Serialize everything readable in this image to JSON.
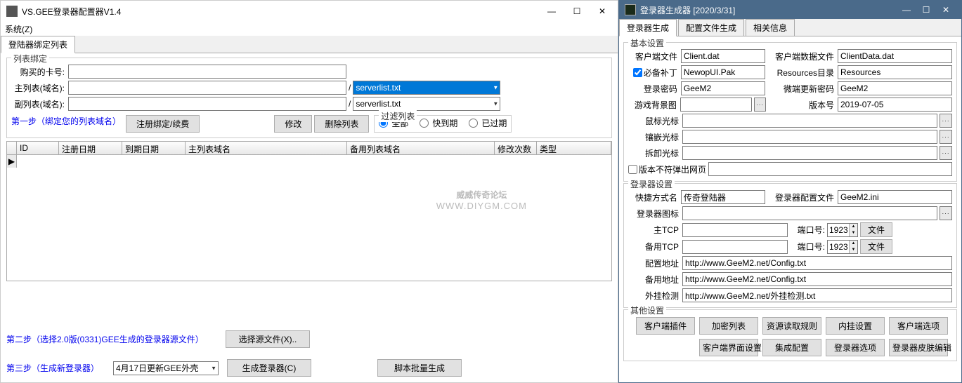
{
  "left": {
    "title": "VS.GEE登录器配置器V1.4",
    "menu": "系统(Z)",
    "tab1": "登陆器绑定列表",
    "listBind": {
      "title": "列表绑定",
      "cardLabel": "购买的卡号:",
      "cardValue": "",
      "mainLabel": "主列表(域名):",
      "mainValue": "",
      "mainSel": "serverlist.txt",
      "subLabel": "副列表(域名):",
      "subValue": "",
      "subSel": "serverlist.txt"
    },
    "step1": "第一步（绑定您的列表域名）",
    "btnReg": "注册绑定/续费",
    "btnMod": "修改",
    "btnDel": "删除列表",
    "filter": {
      "title": "过滤列表",
      "all": "全部",
      "due": "快到期",
      "expired": "已过期"
    },
    "cols": {
      "id": "ID",
      "regDate": "注册日期",
      "expDate": "到期日期",
      "mainDom": "主列表域名",
      "subDom": "备用列表域名",
      "modCount": "修改次数",
      "type": "类型"
    },
    "watermark1": "威威传奇论坛",
    "watermark2": "WWW.DIYGM.COM",
    "step2": "第二步（选择2.0版(0331)GEE生成的登录器源文件）",
    "btnSelSrc": "选择源文件(X)..",
    "step3": "第三步（生成新登录器）",
    "shellSel": "4月17日更新GEE外壳",
    "btnGen": "生成登录器(C)",
    "btnBatch": "脚本批量生成"
  },
  "right": {
    "title": "登录器生成器 [2020/3/31]",
    "tabs": {
      "t1": "登录器生成",
      "t2": "配置文件生成",
      "t3": "相关信息"
    },
    "basic": {
      "title": "基本设置",
      "clientFile": "客户端文件",
      "clientFileV": "Client.dat",
      "clientData": "客户端数据文件",
      "clientDataV": "ClientData.dat",
      "patchChk": "必备补丁",
      "patchV": "NewopUI.Pak",
      "resDir": "Resources目录",
      "resDirV": "Resources",
      "loginPwd": "登录密码",
      "loginPwdV": "GeeM2",
      "microPwd": "微端更新密码",
      "microPwdV": "GeeM2",
      "bgImg": "游戏背景图",
      "bgImgV": "",
      "verNo": "版本号",
      "verNoV": "2019-07-05",
      "mouse": "鼠标光标",
      "mouseV": "",
      "embed": "镶嵌光标",
      "embedV": "",
      "pick": "拆卸光标",
      "pickV": "",
      "popChk": "版本不符弹出网页",
      "popV": ""
    },
    "login": {
      "title": "登录器设置",
      "shortcut": "快捷方式名",
      "shortcutV": "传奇登陆器",
      "cfgFile": "登录器配置文件",
      "cfgFileV": "GeeM2.ini",
      "icon": "登录器图标",
      "iconV": "",
      "mainTcp": "主TCP",
      "mainTcpV": "",
      "port": "端口号:",
      "portV": "1923",
      "fileBtn": "文件",
      "bakTcp": "备用TCP",
      "bakTcpV": "",
      "cfgAddr": "配置地址",
      "cfgAddrV": "http://www.GeeM2.net/Config.txt",
      "bakAddr": "备用地址",
      "bakAddrV": "http://www.GeeM2.net/Config.txt",
      "hack": "外挂检测",
      "hackV": "http://www.GeeM2.net/外挂检测.txt"
    },
    "other": {
      "title": "其他设置",
      "b1": "客户端插件",
      "b2": "加密列表",
      "b3": "资源读取规则",
      "b4": "内挂设置",
      "b5": "客户端选项",
      "b6": "客户端界面设置",
      "b7": "集成配置",
      "b8": "登录器选项",
      "b9": "登录器皮肤编辑"
    }
  }
}
